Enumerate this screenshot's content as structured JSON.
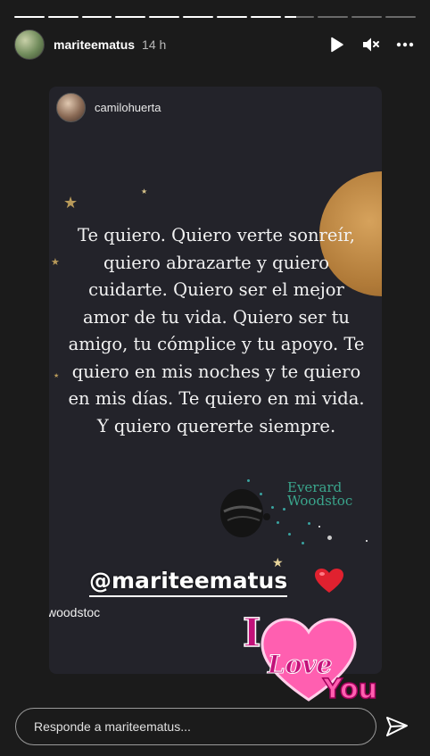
{
  "story": {
    "segments_total": 12,
    "segments_completed": 8,
    "current_segment_fraction": 0.4
  },
  "header": {
    "username": "mariteematus",
    "time": "14 h",
    "play_icon": "play-icon",
    "mute_icon": "muted-speaker-icon",
    "more_icon": "more-dots-icon"
  },
  "shared_post": {
    "username": "camilohuerta",
    "quote": "Te quiero. Quiero verte sonreír, quiero abrazarte y quiero cuidarte. Quiero ser el mejor amor de tu vida. Quiero ser tu amigo, tu cómplice y  tu apoyo. Te quiero en mis noches y te quiero en mis días. Te quiero en mi vida. Y quiero quererte siempre.",
    "signature_line1": "Everard",
    "signature_line2": "Woodstoc",
    "footer_text": "woodstoc"
  },
  "stickers": {
    "mention": "@mariteematus",
    "heart_emoji": "red-heart-icon",
    "love_sticker": {
      "line1": "I",
      "line2": "Love",
      "line3": "You"
    }
  },
  "reply": {
    "placeholder": "Responde a mariteematus...",
    "send_icon": "send-icon"
  },
  "colors": {
    "background": "#1b1b1b",
    "card": "#23232a",
    "signature": "#3aa58c",
    "sticker_pink": "#ff5fb0"
  }
}
